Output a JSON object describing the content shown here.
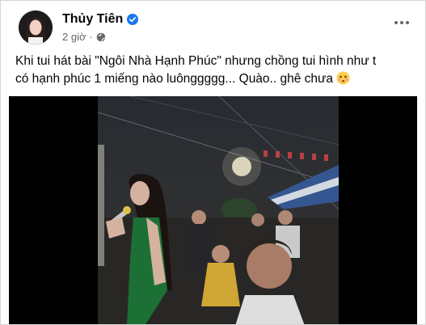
{
  "post": {
    "author_name": "Thủy Tiên",
    "time": "2 giờ",
    "separator": "·",
    "text_line_1": "Khi tui hát bài \"Ngôi Nhà Hạnh Phúc\" nhưng chồng tui hình như t",
    "text_line_2": "có hạnh phúc 1 miếng nào luônggggg... Quào.. ghê chưa"
  },
  "icons": {
    "verified": "verified-badge-icon",
    "privacy": "globe-icon",
    "more": "more-options-icon",
    "emoji": "flushed-face-emoji-icon"
  },
  "colors": {
    "verified_blue": "#1877f2",
    "meta_gray": "#65676b",
    "text_black": "#050505"
  }
}
